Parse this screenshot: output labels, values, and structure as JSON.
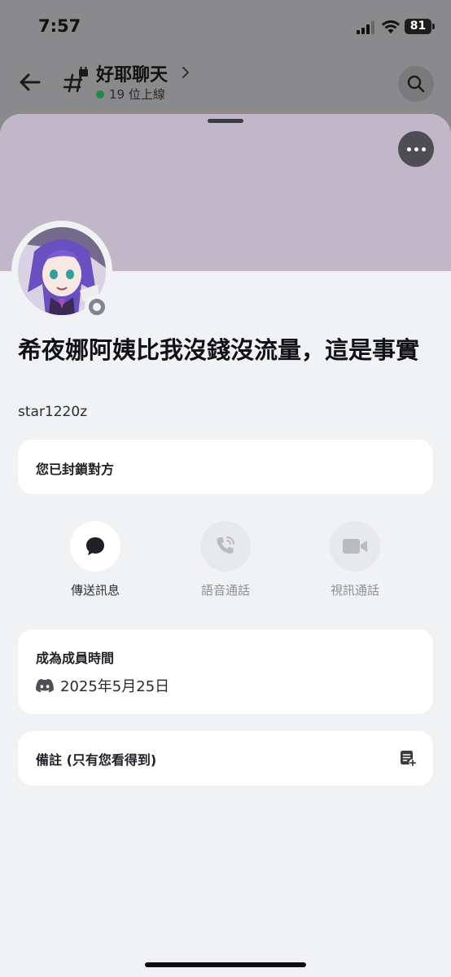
{
  "status_bar": {
    "time": "7:57",
    "battery": "81"
  },
  "channel_header": {
    "name": "好耶聊天",
    "online_count": "19 位上線"
  },
  "profile": {
    "display_name": "希夜娜阿姨比我沒錢沒流量，這是事實",
    "username": "star1220z",
    "blocked_text": "您已封鎖對方"
  },
  "actions": [
    {
      "label": "傳送訊息",
      "icon": "chat-bubble-icon",
      "enabled": true
    },
    {
      "label": "語音通話",
      "icon": "phone-icon",
      "enabled": false
    },
    {
      "label": "視訊通話",
      "icon": "video-camera-icon",
      "enabled": false
    }
  ],
  "member_since": {
    "title": "成為成員時間",
    "date": "2025年5月25日"
  },
  "note": {
    "label": "備註 (只有您看得到)"
  },
  "colors": {
    "banner": "#c1b7c8",
    "sheet_bg": "#f1f2f4",
    "online_green": "#1f8a4a",
    "status_gray": "#80848e"
  }
}
